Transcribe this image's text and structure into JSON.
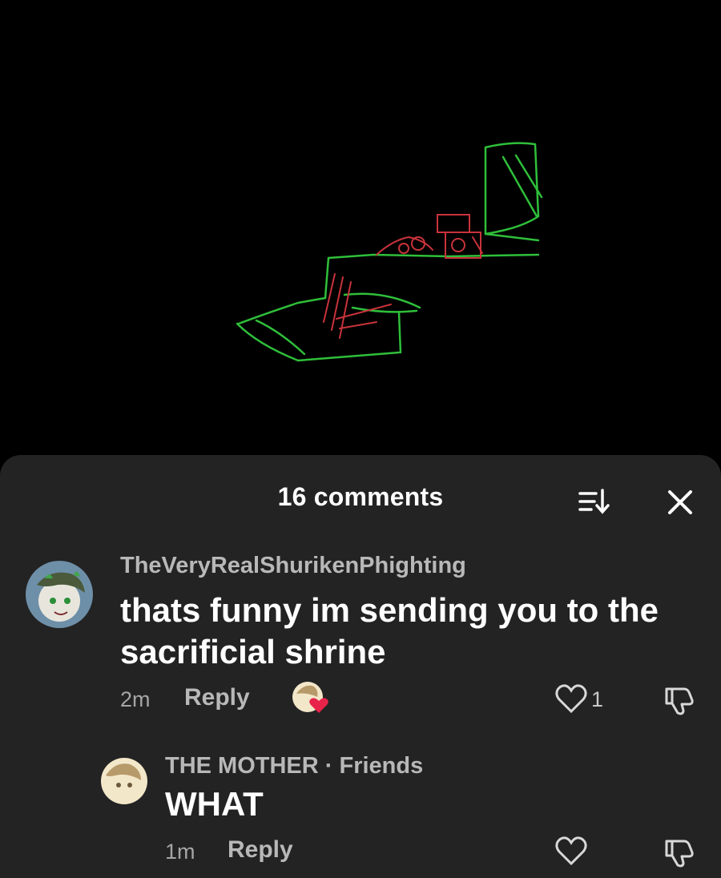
{
  "sheet": {
    "title": "16 comments"
  },
  "comments": [
    {
      "username": "TheVeryRealShurikenPhighting",
      "text": "thats funny im sending you to the sacrificial shrine",
      "time": "2m",
      "reply_label": "Reply",
      "likes": "1",
      "liked_by_creator": true
    },
    {
      "username": "THE MOTHER",
      "badge": "· Friends",
      "text": "WHAT",
      "time": "1m",
      "reply_label": "Reply"
    }
  ],
  "colors": {
    "sheet_bg": "#232323",
    "heart_red": "#e8234a",
    "drawing_green": "#2fbf3a",
    "drawing_red": "#c8333b"
  },
  "icons": [
    "sort-icon",
    "close-icon",
    "heart-icon",
    "dislike-icon"
  ]
}
